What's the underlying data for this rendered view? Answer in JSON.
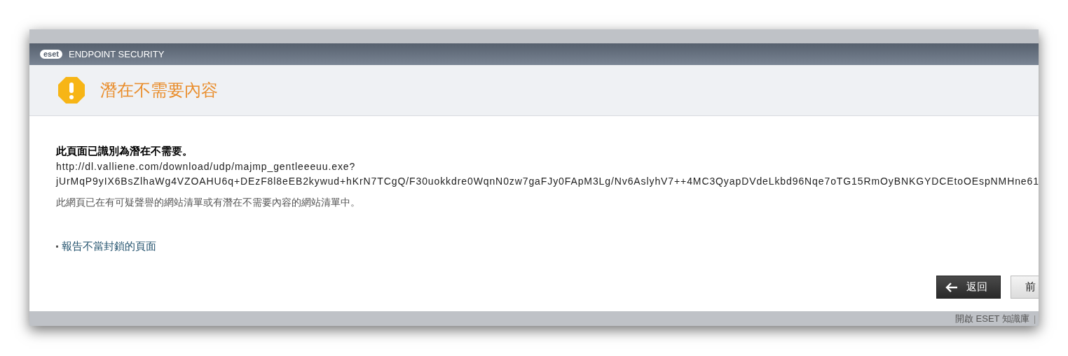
{
  "window": {
    "logo": "eset",
    "title": "ENDPOINT SECURITY"
  },
  "header": {
    "title": "潛在不需要內容"
  },
  "body": {
    "heading": "此頁面已識別為潛在不需要。",
    "url_lines": [
      "http://dl.valliene.com/download/udp/majmp_gentleeeuu.exe?",
      "jUrMqP9yIX6BsZlhaWg4VZOAHU6q+DEzF8l8eEB2kywud+hKrN7TCgQ/F30uokkdre0WqnN0zw7gaFJy0FApM3Lg/Nv6AslyhV7++4MC3QyapDVdeLkbd96Nqe7oTG15RmOyBNKGYDCEtoOEspNMHne61"
    ],
    "description": "此網頁已在有可疑聲譽的網站清單或有潛在不需要內容的網站清單中。",
    "links": [
      "報告不當封鎖的頁面"
    ]
  },
  "buttons": [
    {
      "label": "返回",
      "kind": "back"
    },
    {
      "label": "前",
      "kind": "plain"
    }
  ],
  "status_bar": {
    "link": "開啟 ESET 知識庫",
    "separator": "|"
  }
}
